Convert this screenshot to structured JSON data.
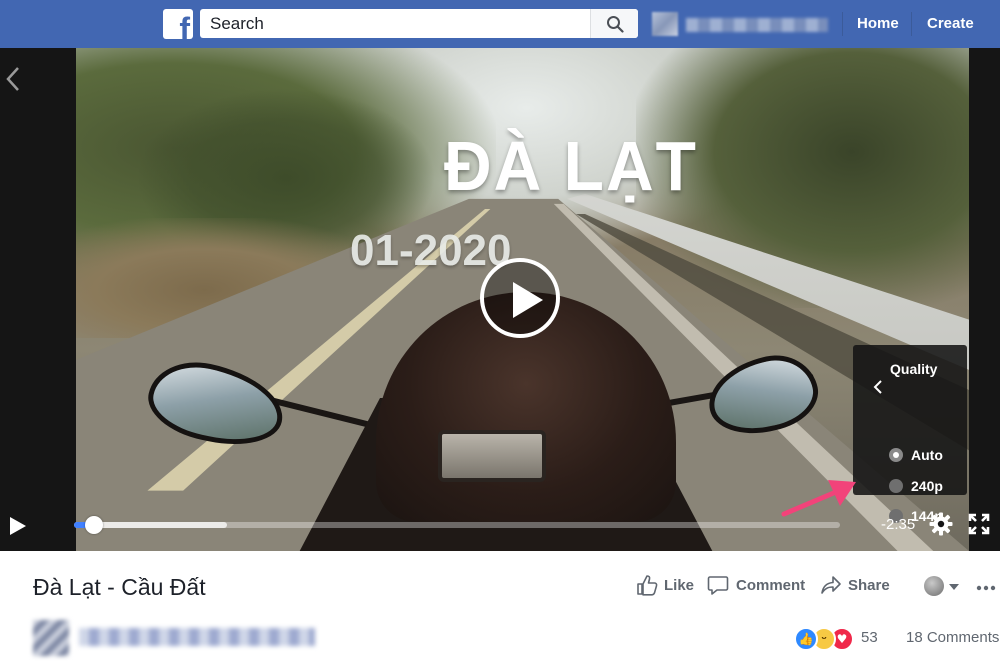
{
  "header": {
    "logo_letter": "f",
    "search_placeholder": "Search",
    "nav_home": "Home",
    "nav_create": "Create",
    "brand_color": "#4267b2"
  },
  "video": {
    "overlay_title": "ĐÀ LẠT",
    "overlay_date": "01-2020",
    "time_remaining": "-2:35",
    "progress_played_fraction": 0.02,
    "progress_buffered_fraction": 0.2,
    "accent_color": "#4080ff",
    "quality_menu": {
      "title": "Quality",
      "options": [
        {
          "label": "Auto",
          "selected": true
        },
        {
          "label": "240p",
          "selected": false
        },
        {
          "label": "144p",
          "selected": false
        }
      ]
    }
  },
  "post": {
    "title": "Đà Lạt - Cầu Đất",
    "actions": {
      "like": "Like",
      "comment": "Comment",
      "share": "Share"
    },
    "reactions": {
      "types": [
        "like",
        "haha",
        "love"
      ],
      "count": "53"
    },
    "comments_count": "18 Comments"
  },
  "icons": {
    "search": "search-icon",
    "settings": "gear-icon",
    "fullscreen": "fullscreen-icon",
    "play": "play-icon",
    "back": "chevron-left-icon"
  }
}
